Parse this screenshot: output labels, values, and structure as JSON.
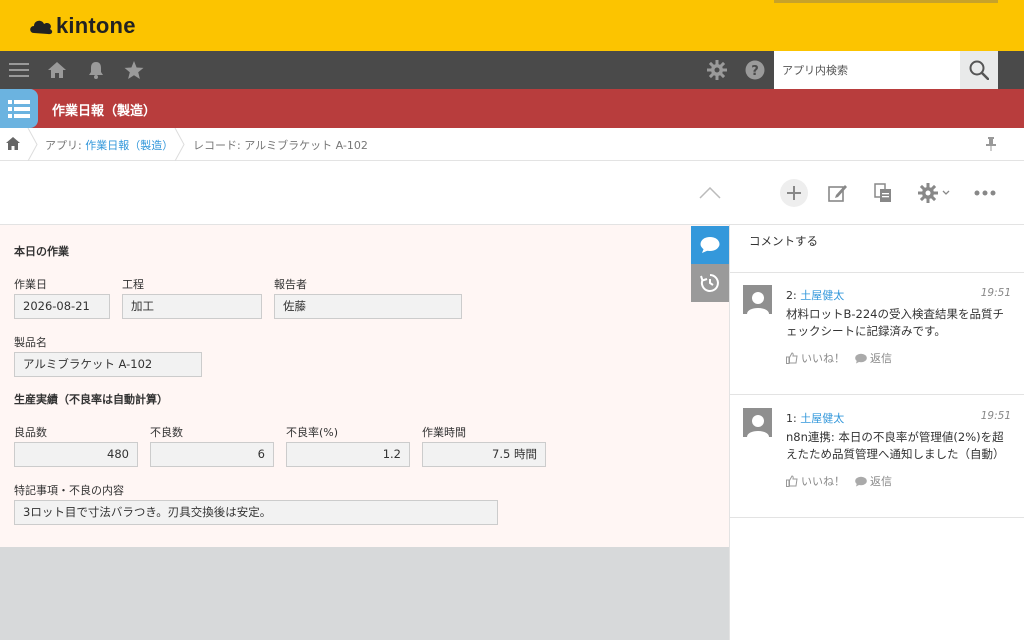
{
  "brand": {
    "name": "kintone"
  },
  "search": {
    "placeholder": "アプリ内検索"
  },
  "app": {
    "title": "作業日報（製造）"
  },
  "breadcrumb": {
    "app_prefix": "アプリ: ",
    "app_link": "作業日報（製造）",
    "record_prefix": "レコード: ",
    "record_name": "アルミブラケット A-102"
  },
  "form": {
    "section_today": "本日の作業",
    "work_date": {
      "label": "作業日",
      "value": "2026-08-21"
    },
    "process": {
      "label": "工程",
      "value": "加工"
    },
    "reporter": {
      "label": "報告者",
      "value": "佐藤"
    },
    "product": {
      "label": "製品名",
      "value": "アルミブラケット A-102"
    },
    "section_results": "生産実績（不良率は自動計算）",
    "good_count": {
      "label": "良品数",
      "value": "480"
    },
    "defect_count": {
      "label": "不良数",
      "value": "6"
    },
    "defect_rate": {
      "label": "不良率(%)",
      "value": "1.2"
    },
    "work_time": {
      "label": "作業時間",
      "value": "7.5 時間"
    },
    "notes": {
      "label": "特記事項・不良の内容",
      "value": "3ロット目で寸法バラつき。刃具交換後は安定。"
    }
  },
  "comments": {
    "input_placeholder": "コメントする",
    "items": [
      {
        "index": "2:",
        "author": "土屋健太",
        "time": "19:51",
        "body": "材料ロットB-224の受入検査結果を品質チェックシートに記録済みです。",
        "like": "いいね！",
        "reply": "返信"
      },
      {
        "index": "1:",
        "author": "土屋健太",
        "time": "19:51",
        "body": "n8n連携: 本日の不良率が管理値(2%)を超えたため品質管理へ通知しました（自動）",
        "like": "いいね！",
        "reply": "返信"
      }
    ]
  },
  "colors": {
    "header_yellow": "#fcc400",
    "nav_gray": "#4a4a4a",
    "app_bar_red": "#b83d3d",
    "link_blue": "#3498db",
    "side_tab_blue": "#3498db",
    "form_bg": "#fff6f4"
  }
}
